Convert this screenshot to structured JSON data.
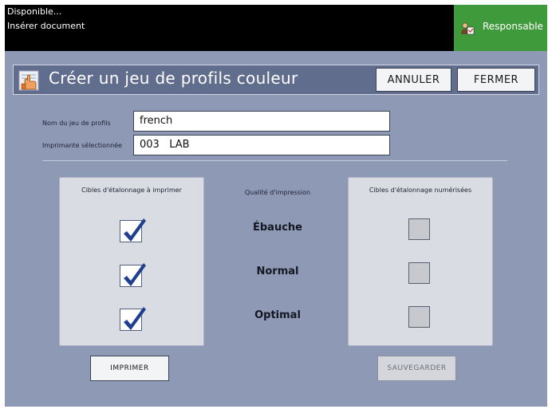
{
  "status": {
    "line1": "Disponible...",
    "line2": "Insérer document"
  },
  "user_role": "Responsable",
  "dialog": {
    "title": "Créer un jeu de profils couleur",
    "cancel_label": "ANNULER",
    "close_label": "FERMER"
  },
  "form": {
    "profile_set_label": "Nom du jeu de profils",
    "profile_set_value": "french",
    "printer_label": "Imprimante sélectionnée",
    "printer_value": "003   LAB"
  },
  "print_targets": {
    "title": "Cibles d'étalonnage à imprimer",
    "checked": [
      true,
      true,
      true
    ]
  },
  "quality": {
    "title": "Qualité d'impression",
    "levels": [
      "Ébauche",
      "Normal",
      "Optimal"
    ]
  },
  "scanned_targets": {
    "title": "Cibles d'étalonnage numérisées",
    "checked": [
      false,
      false,
      false
    ]
  },
  "buttons": {
    "print_label": "IMPRIMER",
    "save_label": "SAUVEGARDER"
  },
  "colors": {
    "topbar": "#000000",
    "role_badge": "#3e9a3a",
    "panel": "#8e99b6",
    "header": "#616d8d",
    "checkmark": "#1f3f8f"
  }
}
